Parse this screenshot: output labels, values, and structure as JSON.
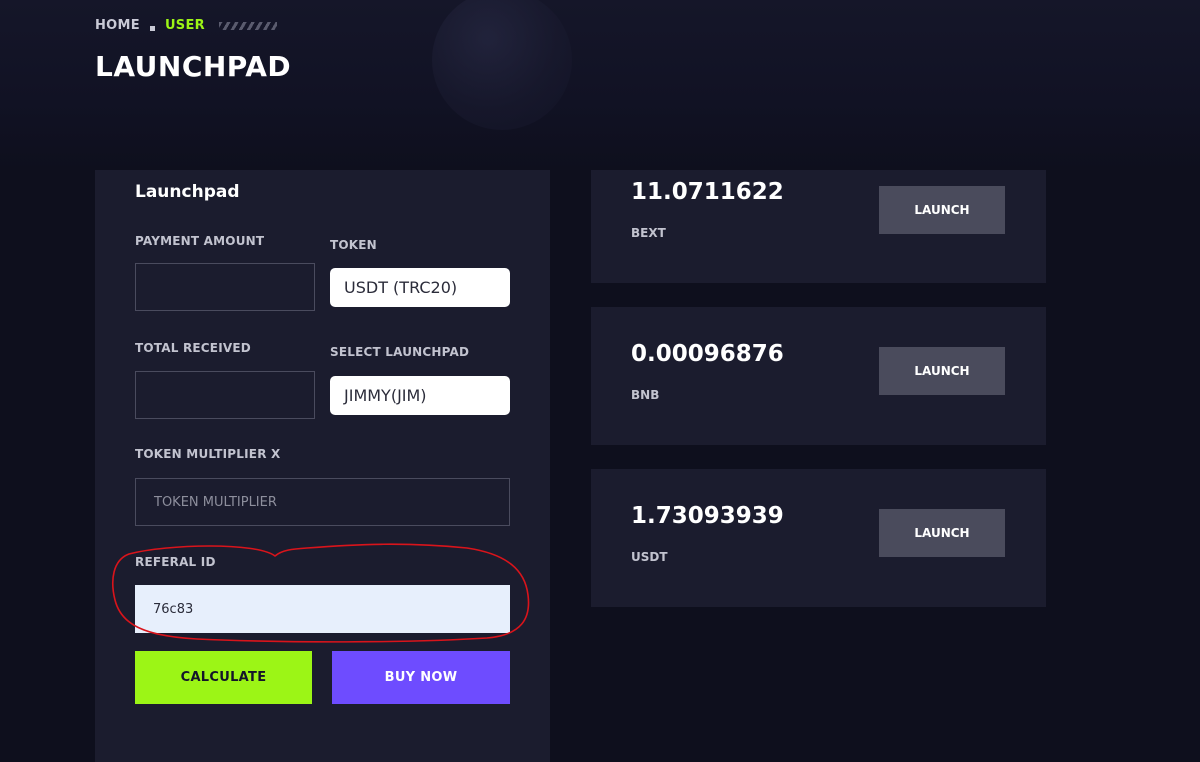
{
  "breadcrumb": {
    "home": "HOME",
    "user": "USER"
  },
  "page_title": "LAUNCHPAD",
  "form": {
    "title": "Launchpad",
    "payment_amount_label": "PAYMENT AMOUNT",
    "payment_amount_value": "",
    "token_label": "TOKEN",
    "token_value": "USDT (TRC20)",
    "total_received_label": "TOTAL RECEIVED",
    "total_received_value": "",
    "select_launchpad_label": "SELECT LAUNCHPAD",
    "select_launchpad_value": "JIMMY(JIM)",
    "token_multiplier_label": "TOKEN MULTIPLIER X",
    "token_multiplier_placeholder": "TOKEN MULTIPLIER",
    "referal_label": "REFERAL ID",
    "referal_value": "76c83",
    "calculate_label": "CALCULATE",
    "buy_now_label": "BUY NOW"
  },
  "balances": [
    {
      "amount": "11.0711622",
      "symbol": "BEXT",
      "action": "LAUNCH"
    },
    {
      "amount": "0.00096876",
      "symbol": "BNB",
      "action": "LAUNCH"
    },
    {
      "amount": "1.73093939",
      "symbol": "USDT",
      "action": "LAUNCH"
    }
  ],
  "colors": {
    "accent_green": "#9cf516",
    "accent_purple": "#6e4cff",
    "annotation_red": "#d9141b"
  }
}
